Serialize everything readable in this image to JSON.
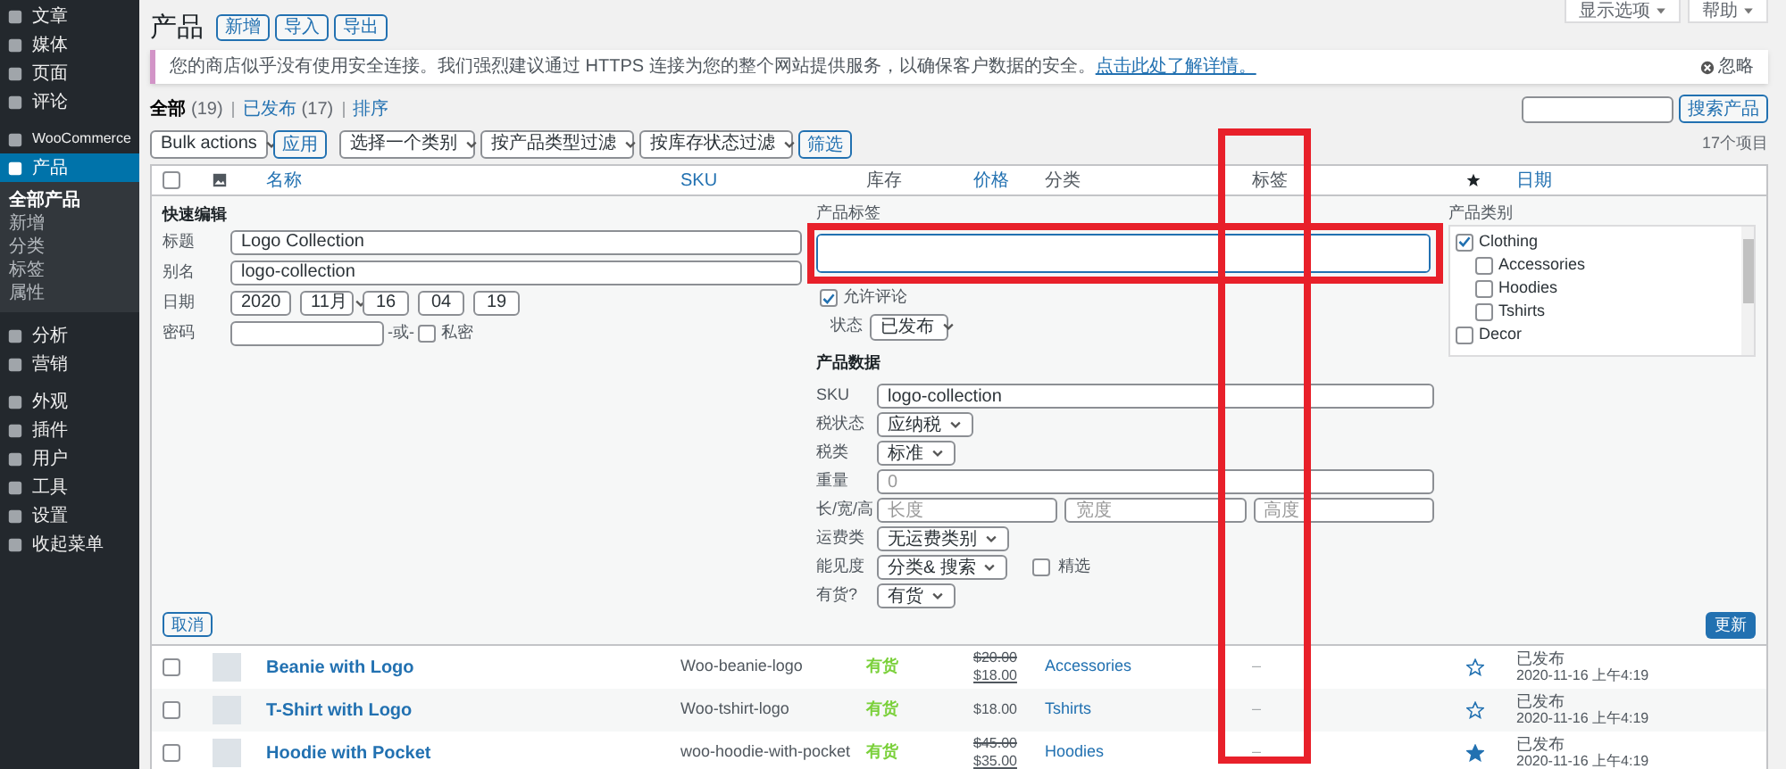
{
  "sidebar": {
    "items": [
      {
        "label": "文章",
        "selected": false
      },
      {
        "label": "媒体",
        "selected": false
      },
      {
        "label": "页面",
        "selected": false
      },
      {
        "label": "评论",
        "selected": false
      },
      {
        "label": "WooCommerce",
        "selected": false
      },
      {
        "label": "产品",
        "selected": true,
        "children": [
          {
            "label": "全部产品",
            "selected": true
          },
          {
            "label": "新增",
            "selected": false
          },
          {
            "label": "分类",
            "selected": false
          },
          {
            "label": "标签",
            "selected": false
          },
          {
            "label": "属性",
            "selected": false
          }
        ]
      },
      {
        "label": "分析",
        "selected": false
      },
      {
        "label": "营销",
        "selected": false
      },
      {
        "label": "外观",
        "selected": false
      },
      {
        "label": "插件",
        "selected": false
      },
      {
        "label": "用户",
        "selected": false
      },
      {
        "label": "工具",
        "selected": false
      },
      {
        "label": "设置",
        "selected": false
      },
      {
        "label": "收起菜单",
        "selected": false
      }
    ]
  },
  "screen_tabs": [
    "显示选项",
    "帮助"
  ],
  "heading": {
    "title": "产品",
    "buttons": [
      "新增",
      "导入",
      "导出"
    ]
  },
  "notice": {
    "text": "您的商店似乎没有使用安全连接。我们强烈建议通过 HTTPS 连接为您的整个网站提供服务，以确保客户数据的安全。",
    "link": "点击此处了解详情。",
    "dismiss": "忽略"
  },
  "search": {
    "button": "搜索产品"
  },
  "views": [
    {
      "label": "全部",
      "count": "(19)",
      "selected": true
    },
    {
      "label": "已发布",
      "count": "(17)",
      "selected": false
    },
    {
      "label": "排序",
      "selected": false
    }
  ],
  "bulk_action": "Bulk actions",
  "apply": "应用",
  "filter_selects": [
    "选择一个类别",
    "按产品类型过滤",
    "按库存状态过滤"
  ],
  "filter_button": "筛选",
  "item_count": "17个项目",
  "table": {
    "select_all_checked": false,
    "columns": [
      {
        "kind": "checkbox"
      },
      {
        "kind": "image"
      },
      {
        "kind": "text",
        "label": "名称",
        "sortable": true
      },
      {
        "kind": "text",
        "label": "SKU",
        "sortable": true
      },
      {
        "kind": "text",
        "label": "库存",
        "sortable": false
      },
      {
        "kind": "text",
        "label": "价格",
        "sortable": true
      },
      {
        "kind": "text",
        "label": "分类",
        "sortable": false
      },
      {
        "kind": "text",
        "label": "标签",
        "sortable": false
      },
      {
        "kind": "star"
      },
      {
        "kind": "text",
        "label": "日期",
        "sortable": true
      }
    ],
    "rows": [
      {
        "selected": false,
        "name": "Beanie with Logo",
        "sku": "Woo-beanie-logo",
        "stock": "有货",
        "regular_price": "$20.00",
        "price": "$18.00",
        "category": "Accessories",
        "tags": "–",
        "featured": false,
        "status": "已发布",
        "date": "2020-11-16 上午4:19"
      },
      {
        "selected": false,
        "name": "T-Shirt with Logo",
        "sku": "Woo-tshirt-logo",
        "stock": "有货",
        "price": "$18.00",
        "category": "Tshirts",
        "tags": "–",
        "featured": false,
        "status": "已发布",
        "date": "2020-11-16 上午4:19"
      },
      {
        "selected": false,
        "name": "Hoodie with Pocket",
        "sku": "woo-hoodie-with-pocket",
        "stock": "有货",
        "regular_price": "$45.00",
        "price": "$35.00",
        "category": "Hoodies",
        "tags": "–",
        "featured": true,
        "status": "已发布",
        "date": "2020-11-16 上午4:19"
      }
    ]
  },
  "quick_edit": {
    "title": "快速编辑",
    "fields": [
      {
        "label": "标题",
        "value": "Logo Collection"
      },
      {
        "label": "别名",
        "value": "logo-collection"
      }
    ],
    "date": {
      "label": "日期",
      "parts": [
        "2020",
        "11月",
        "16",
        "04",
        "19"
      ]
    },
    "password": {
      "label": "密码",
      "separator": "-或-",
      "private_label": "私密",
      "private_checked": false
    },
    "tags_label": "产品标签",
    "allow_comments": {
      "label": "允许评论",
      "checked": true
    },
    "status": {
      "label": "状态",
      "value": "已发布"
    },
    "product_data_title": "产品数据",
    "product_data": [
      {
        "kind": "text",
        "label": "SKU",
        "value": "logo-collection"
      },
      {
        "kind": "select",
        "label": "税状态",
        "value": "应纳税"
      },
      {
        "kind": "select",
        "label": "税类",
        "value": "标准"
      },
      {
        "kind": "text",
        "label": "重量",
        "placeholder": "0"
      },
      {
        "kind": "dimensions",
        "label": "长/宽/高",
        "placeholders": [
          "长度",
          "宽度",
          "高度"
        ]
      },
      {
        "kind": "select",
        "label": "运费类",
        "value": "无运费类别"
      },
      {
        "kind": "select",
        "label": "能见度",
        "value": "分类& 搜索",
        "checkbox": {
          "label": "精选",
          "checked": false
        }
      },
      {
        "kind": "select",
        "label": "有货?",
        "value": "有货"
      }
    ],
    "categories_label": "产品类别",
    "categories": [
      {
        "label": "Clothing",
        "checked": true,
        "children": [
          {
            "label": "Accessories",
            "checked": false
          },
          {
            "label": "Hoodies",
            "checked": false
          },
          {
            "label": "Tshirts",
            "checked": false
          }
        ]
      },
      {
        "label": "Decor",
        "checked": false
      }
    ],
    "cancel": "取消",
    "update": "更新"
  },
  "annotation_frames": {
    "tags_column_frame": true,
    "tags_field_frame": true
  }
}
